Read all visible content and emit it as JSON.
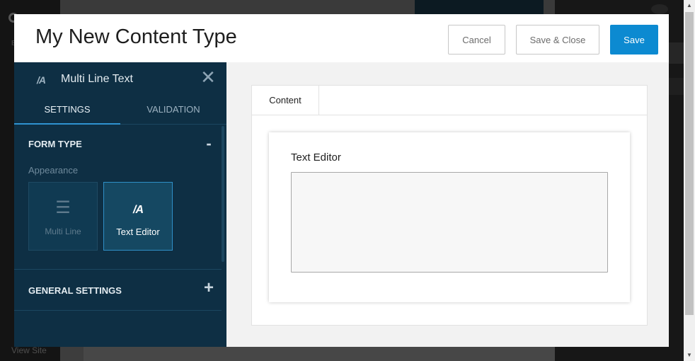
{
  "background": {
    "view_site_label": "View Site",
    "nav_letter": "B"
  },
  "modal": {
    "title": "My New Content Type",
    "buttons": {
      "cancel": "Cancel",
      "save_close": "Save & Close",
      "save": "Save"
    }
  },
  "settings_panel": {
    "field_icon": "text-editor-icon",
    "field_icon_glyph": "/A",
    "title": "Multi Line Text",
    "close_glyph": "✕",
    "tabs": [
      {
        "label": "SETTINGS",
        "active": true
      },
      {
        "label": "VALIDATION",
        "active": false
      }
    ],
    "form_type": {
      "title": "FORM TYPE",
      "toggle": "-",
      "appearance_label": "Appearance",
      "options": [
        {
          "label": "Multi Line",
          "icon": "lines-icon",
          "glyph": "☰",
          "selected": false
        },
        {
          "label": "Text Editor",
          "icon": "text-editor-icon",
          "glyph": "/A",
          "selected": true
        }
      ]
    },
    "general_settings": {
      "title": "GENERAL SETTINGS",
      "toggle": "+"
    }
  },
  "preview": {
    "tab_label": "Content",
    "field_label": "Text Editor"
  },
  "colors": {
    "accent": "#0c8ad1",
    "panel_bg": "#0e2f44",
    "selected_border": "#2f8fc7"
  }
}
